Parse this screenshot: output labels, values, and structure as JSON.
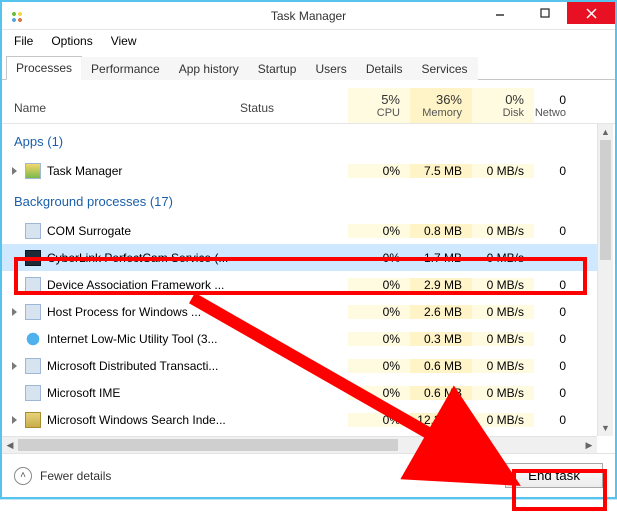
{
  "window": {
    "title": "Task Manager"
  },
  "menubar": {
    "file": "File",
    "options": "Options",
    "view": "View"
  },
  "tabs": {
    "processes": "Processes",
    "performance": "Performance",
    "app_history": "App history",
    "startup": "Startup",
    "users": "Users",
    "details": "Details",
    "services": "Services"
  },
  "columns": {
    "name": "Name",
    "status": "Status",
    "cpu_pct": "5%",
    "cpu_lbl": "CPU",
    "mem_pct": "36%",
    "mem_lbl": "Memory",
    "disk_pct": "0%",
    "disk_lbl": "Disk",
    "net_lbl": "Netwo",
    "net_pct": "0"
  },
  "groups": {
    "apps": "Apps (1)",
    "bg": "Background processes (17)"
  },
  "apps": [
    {
      "name": "Task Manager",
      "cpu": "0%",
      "mem": "7.5 MB",
      "disk": "0 MB/s",
      "net": "0"
    }
  ],
  "bg": [
    {
      "name": "COM Surrogate",
      "cpu": "0%",
      "mem": "0.8 MB",
      "disk": "0 MB/s",
      "net": "0"
    },
    {
      "name": "CyberLink PerfectCam Service (...",
      "cpu": "0%",
      "mem": "1.7 MB",
      "disk": "0 MB/s",
      "net": ""
    },
    {
      "name": "Device Association Framework ...",
      "cpu": "0%",
      "mem": "2.9 MB",
      "disk": "0 MB/s",
      "net": "0"
    },
    {
      "name": "Host Process for Windows ...",
      "cpu": "0%",
      "mem": "2.6 MB",
      "disk": "0 MB/s",
      "net": "0"
    },
    {
      "name": "Internet Low-Mic Utility Tool (3...",
      "cpu": "0%",
      "mem": "0.3 MB",
      "disk": "0 MB/s",
      "net": "0"
    },
    {
      "name": "Microsoft Distributed Transacti...",
      "cpu": "0%",
      "mem": "0.6 MB",
      "disk": "0 MB/s",
      "net": "0"
    },
    {
      "name": "Microsoft IME",
      "cpu": "0%",
      "mem": "0.6 MB",
      "disk": "0 MB/s",
      "net": "0"
    },
    {
      "name": "Microsoft Windows Search Inde...",
      "cpu": "0%",
      "mem": "12.3 MB",
      "disk": "0 MB/s",
      "net": "0"
    }
  ],
  "footer": {
    "fewer": "Fewer details",
    "endtask": "End task"
  }
}
